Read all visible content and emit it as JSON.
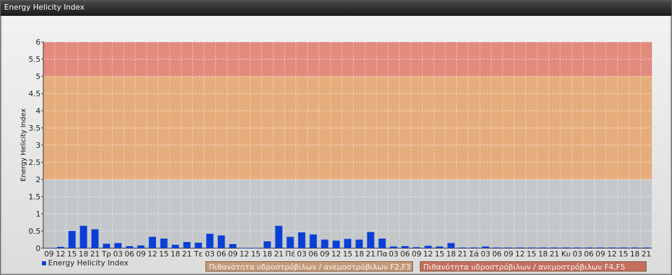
{
  "window": {
    "title": "Energy Helicity Index"
  },
  "chart_data": {
    "type": "bar",
    "ylabel": "Energy Helicity Index",
    "ylim": [
      0,
      6
    ],
    "yticks": [
      "0",
      "0.5",
      "1",
      "1.5",
      "2",
      "2.5",
      "3",
      "3.5",
      "4",
      "4.5",
      "5",
      "5.5",
      "6"
    ],
    "categories": [
      "09",
      "12",
      "15",
      "18",
      "21",
      "Τρ",
      "03",
      "06",
      "09",
      "12",
      "15",
      "18",
      "21",
      "Τε",
      "03",
      "06",
      "09",
      "12",
      "15",
      "18",
      "21",
      "Πέ",
      "03",
      "06",
      "09",
      "12",
      "15",
      "18",
      "21",
      "Πα",
      "03",
      "06",
      "09",
      "12",
      "15",
      "18",
      "21",
      "Σά",
      "03",
      "06",
      "09",
      "12",
      "15",
      "18",
      "21",
      "Κυ",
      "03",
      "06",
      "09",
      "12",
      "15",
      "18",
      "21"
    ],
    "series": [
      {
        "name": "Energy Helicity Index",
        "color": "#0a3fd6",
        "values": [
          0.01,
          0.04,
          0.5,
          0.65,
          0.55,
          0.13,
          0.15,
          0.06,
          0.08,
          0.33,
          0.28,
          0.1,
          0.18,
          0.16,
          0.42,
          0.37,
          0.12,
          0.01,
          0.01,
          0.2,
          0.65,
          0.33,
          0.46,
          0.4,
          0.25,
          0.22,
          0.27,
          0.25,
          0.47,
          0.28,
          0.05,
          0.06,
          0.03,
          0.07,
          0.05,
          0.15,
          0.02,
          0.02,
          0.05,
          0.02,
          0.02,
          0.02,
          0.02,
          0.02,
          0.02,
          0.02,
          0.02,
          0.02,
          0.02,
          0.02,
          0.02,
          0.02,
          0.02,
          0.13
        ]
      }
    ],
    "bands": [
      {
        "from": 0,
        "to": 2,
        "color": "#c0c4c8"
      },
      {
        "from": 2,
        "to": 5,
        "color": "#e6a670"
      },
      {
        "from": 5,
        "to": 6,
        "color": "#e08070"
      }
    ],
    "legend": [
      {
        "label": "Energy Helicity Index",
        "color": "#0a3fd6"
      },
      {
        "label": "Πιθανότητα υδροστρόβιλων / ανεμοστρόβιλων F2,F3",
        "color": "#c49a78"
      },
      {
        "label": "Πιθανότητα υδροστρόβιλων / ανεμοστρόβιλων F4,F5",
        "color": "#c46e5e"
      }
    ],
    "grid": true
  }
}
